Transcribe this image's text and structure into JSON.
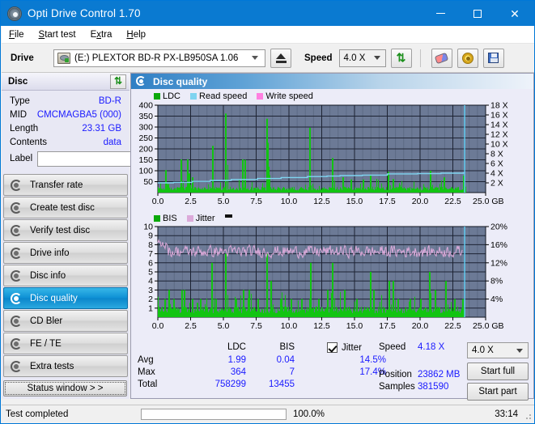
{
  "window": {
    "title": "Opti Drive Control 1.70",
    "icon": "disc-icon",
    "minimize": "–",
    "maximize": "□",
    "close": "✕"
  },
  "menu": [
    {
      "label": "File",
      "accel": "F"
    },
    {
      "label": "Start test",
      "accel": "S"
    },
    {
      "label": "Extra",
      "accel": "x"
    },
    {
      "label": "Help",
      "accel": "H"
    }
  ],
  "toolbar": {
    "drive_label": "Drive",
    "drive_value": "(E:)  PLEXTOR BD-R  PX-LB950SA 1.06",
    "eject_title": "Eject",
    "speed_label": "Speed",
    "speed_value": "4.0 X",
    "refresh_icon": "refresh-icon",
    "erase_icon": "erase-icon",
    "settings_icon": "gear-icon",
    "save_icon": "save-icon"
  },
  "disc_panel": {
    "title": "Disc",
    "refresh_icon": "refresh-icon",
    "rows": [
      {
        "key": "Type",
        "value": "BD-R"
      },
      {
        "key": "MID",
        "value": "CMCMAGBA5 (000)"
      },
      {
        "key": "Length",
        "value": "23.31 GB"
      },
      {
        "key": "Contents",
        "value": "data"
      }
    ],
    "label_key": "Label",
    "label_value": "",
    "label_placeholder": "",
    "label_button_icon": "disc-icon"
  },
  "nav": {
    "items": [
      {
        "label": "Transfer rate",
        "icon": "disc-icon",
        "selected": false
      },
      {
        "label": "Create test disc",
        "icon": "disc-icon",
        "selected": false
      },
      {
        "label": "Verify test disc",
        "icon": "disc-icon",
        "selected": false
      },
      {
        "label": "Drive info",
        "icon": "disc-icon",
        "selected": false
      },
      {
        "label": "Disc info",
        "icon": "disc-icon",
        "selected": false
      },
      {
        "label": "Disc quality",
        "icon": "disc-icon",
        "selected": true
      },
      {
        "label": "CD Bler",
        "icon": "disc-icon",
        "selected": false
      },
      {
        "label": "FE / TE",
        "icon": "disc-icon",
        "selected": false
      },
      {
        "label": "Extra tests",
        "icon": "disc-icon",
        "selected": false
      }
    ],
    "status_window": "Status window > >"
  },
  "panel": {
    "title": "Disc quality",
    "icon": "disc-icon"
  },
  "stats": {
    "col_ldc": "LDC",
    "col_bis": "BIS",
    "jitter_label": "Jitter",
    "jitter_checked": true,
    "rows": [
      {
        "label": "Avg",
        "ldc": "1.99",
        "bis": "0.04",
        "jitter": "14.5%"
      },
      {
        "label": "Max",
        "ldc": "364",
        "bis": "7",
        "jitter": "17.4%"
      },
      {
        "label": "Total",
        "ldc": "758299",
        "bis": "13455",
        "jitter": ""
      }
    ],
    "speed_label": "Speed",
    "speed_value": "4.18 X",
    "position_label": "Position",
    "position_value": "23862 MB",
    "samples_label": "Samples",
    "samples_value": "381590",
    "speed_select": "4.0 X",
    "start_full": "Start full",
    "start_part": "Start part"
  },
  "statusbar": {
    "text": "Test completed",
    "percent_label": "100.0%",
    "percent": 100,
    "time": "33:14"
  },
  "colors": {
    "accent": "#0a7ad1",
    "plot_bg": "#6c7a96",
    "ldc_green": "#12c412",
    "read_speed": "#7fd4f0",
    "write_speed": "#ff7fe0",
    "jitter_pink": "#dcaada",
    "value_blue": "#1a1aff"
  },
  "chart_data": [
    {
      "type": "line",
      "name": "LDC / Read speed",
      "title": "",
      "xlabel": "GB",
      "ylabel": "",
      "xlim": [
        0,
        25
      ],
      "xticks": [
        "0.0",
        "2.5",
        "5.0",
        "7.5",
        "10.0",
        "12.5",
        "15.0",
        "17.5",
        "20.0",
        "22.5",
        "25.0 GB"
      ],
      "ylim": [
        0,
        400
      ],
      "yticks": [
        "50",
        "100",
        "150",
        "200",
        "250",
        "300",
        "350",
        "400"
      ],
      "y2lim": [
        0,
        18
      ],
      "y2ticks": [
        "2 X",
        "4 X",
        "6 X",
        "8 X",
        "10 X",
        "12 X",
        "14 X",
        "16 X",
        "18 X"
      ],
      "grid": true,
      "legend": [
        {
          "label": "LDC",
          "color": "#0aa80a"
        },
        {
          "label": "Read speed",
          "color": "#7fd4f0"
        },
        {
          "label": "Write speed",
          "color": "#ff7fe0"
        }
      ],
      "series": [
        {
          "name": "LDC",
          "type": "bar",
          "color": "#12c412",
          "axis": "left",
          "x_end": 23.4,
          "baseline_avg": 18,
          "spikes": [
            [
              0.55,
              103
            ],
            [
              1.75,
              152
            ],
            [
              2.2,
              152
            ],
            [
              2.35,
              88
            ],
            [
              2.6,
              70
            ],
            [
              4.15,
              214
            ],
            [
              5.15,
              362
            ],
            [
              6.45,
              152
            ],
            [
              6.6,
              150
            ],
            [
              8.3,
              338
            ],
            [
              8.35,
              228
            ],
            [
              11.55,
              297
            ],
            [
              13.3,
              158
            ],
            [
              14.1,
              70
            ],
            [
              15.6,
              60
            ],
            [
              16.2,
              78
            ],
            [
              17.55,
              95
            ],
            [
              17.9,
              62
            ],
            [
              20.75,
              100
            ],
            [
              21.8,
              70
            ],
            [
              23.3,
              78
            ]
          ]
        },
        {
          "name": "Read speed",
          "type": "line",
          "color": "#7fd4f0",
          "axis": "right",
          "points": [
            [
              0.0,
              2.0
            ],
            [
              1.2,
              2.1
            ],
            [
              2.6,
              2.3
            ],
            [
              4.0,
              2.5
            ],
            [
              5.6,
              2.7
            ],
            [
              7.6,
              2.9
            ],
            [
              9.4,
              3.1
            ],
            [
              11.4,
              3.3
            ],
            [
              12.9,
              3.4
            ],
            [
              13.9,
              3.5
            ],
            [
              15.6,
              3.6
            ],
            [
              17.5,
              3.85
            ],
            [
              19.8,
              3.9
            ],
            [
              21.6,
              4.0
            ],
            [
              23.3,
              4.05
            ]
          ],
          "end_marker_x": 23.4
        }
      ]
    },
    {
      "type": "line",
      "name": "BIS / Jitter",
      "title": "",
      "xlabel": "GB",
      "ylabel": "",
      "xlim": [
        0,
        25
      ],
      "xticks": [
        "0.0",
        "2.5",
        "5.0",
        "7.5",
        "10.0",
        "12.5",
        "15.0",
        "17.5",
        "20.0",
        "22.5",
        "25.0 GB"
      ],
      "ylim": [
        0,
        10
      ],
      "yticks": [
        "1",
        "2",
        "3",
        "4",
        "5",
        "6",
        "7",
        "8",
        "9",
        "10"
      ],
      "y2lim": [
        0,
        20
      ],
      "y2ticks": [
        "4%",
        "8%",
        "12%",
        "16%",
        "20%"
      ],
      "grid": true,
      "legend": [
        {
          "label": "BIS",
          "color": "#0aa80a"
        },
        {
          "label": "Jitter",
          "color": "#dcaada"
        }
      ],
      "series": [
        {
          "name": "BIS",
          "type": "bar",
          "color": "#12c412",
          "axis": "left",
          "x_end": 23.4,
          "baseline_avg": 1,
          "spikes": [
            [
              0.5,
              2
            ],
            [
              0.8,
              3
            ],
            [
              1.15,
              2
            ],
            [
              1.8,
              3
            ],
            [
              1.95,
              3
            ],
            [
              2.6,
              2
            ],
            [
              3.2,
              2
            ],
            [
              4.1,
              6
            ],
            [
              4.4,
              2
            ],
            [
              5.15,
              7
            ],
            [
              5.9,
              2
            ],
            [
              6.5,
              3
            ],
            [
              6.9,
              3
            ],
            [
              7.6,
              2
            ],
            [
              8.3,
              7
            ],
            [
              8.6,
              4
            ],
            [
              9.3,
              2
            ],
            [
              10.1,
              2
            ],
            [
              10.9,
              2
            ],
            [
              11.6,
              6
            ],
            [
              12.2,
              2
            ],
            [
              12.9,
              3
            ],
            [
              13.3,
              6
            ],
            [
              14.2,
              3
            ],
            [
              15.1,
              2
            ],
            [
              16.2,
              5
            ],
            [
              16.4,
              3
            ],
            [
              17.6,
              4
            ],
            [
              17.9,
              4
            ],
            [
              18.3,
              2
            ],
            [
              19.2,
              2
            ],
            [
              20.0,
              2
            ],
            [
              20.7,
              5
            ],
            [
              21.1,
              3
            ],
            [
              21.9,
              4
            ],
            [
              22.6,
              2
            ],
            [
              23.2,
              2
            ]
          ]
        },
        {
          "name": "Jitter",
          "type": "line",
          "color": "#dcaada",
          "axis": "right",
          "mean_pct": 14.5,
          "min_pct": 12.4,
          "max_pct": 17.4,
          "x_end": 23.3
        }
      ]
    }
  ]
}
